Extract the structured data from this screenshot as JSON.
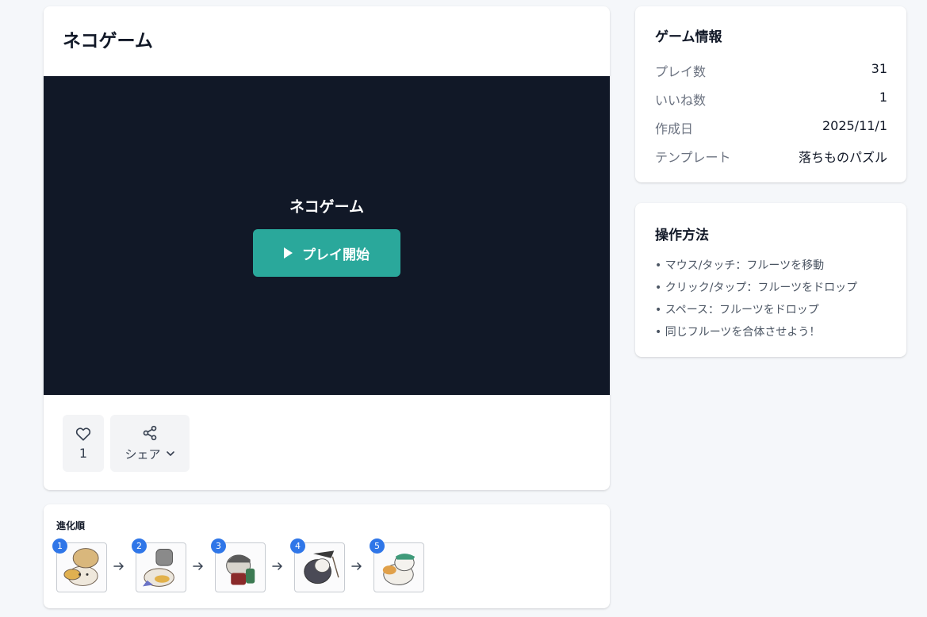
{
  "game": {
    "title": "ネコゲーム",
    "area_title": "ネコゲーム",
    "play_label": "プレイ開始",
    "like_count": "1",
    "share_label": "シェア"
  },
  "evolution": {
    "title": "進化順",
    "items": [
      {
        "number": "1",
        "icon": "cat-with-hat-icon"
      },
      {
        "number": "2",
        "icon": "cat-with-goggles-icon"
      },
      {
        "number": "3",
        "icon": "cat-with-cap-icon"
      },
      {
        "number": "4",
        "icon": "cat-with-cloak-icon"
      },
      {
        "number": "5",
        "icon": "cat-with-bandana-icon"
      }
    ]
  },
  "info": {
    "title": "ゲーム情報",
    "rows": [
      {
        "label": "プレイ数",
        "value": "31"
      },
      {
        "label": "いいね数",
        "value": "1"
      },
      {
        "label": "作成日",
        "value": "2025/11/1"
      },
      {
        "label": "テンプレート",
        "value": "落ちものパズル"
      }
    ]
  },
  "controls": {
    "title": "操作方法",
    "lines": [
      "• マウス/タッチ：フルーツを移動",
      "• クリック/タップ：フルーツをドロップ",
      "• スペース：フルーツをドロップ",
      "• 同じフルーツを合体させよう！"
    ]
  },
  "colors": {
    "accent": "#2aa89b",
    "game_bg": "#111827",
    "badge": "#2f76e8"
  }
}
